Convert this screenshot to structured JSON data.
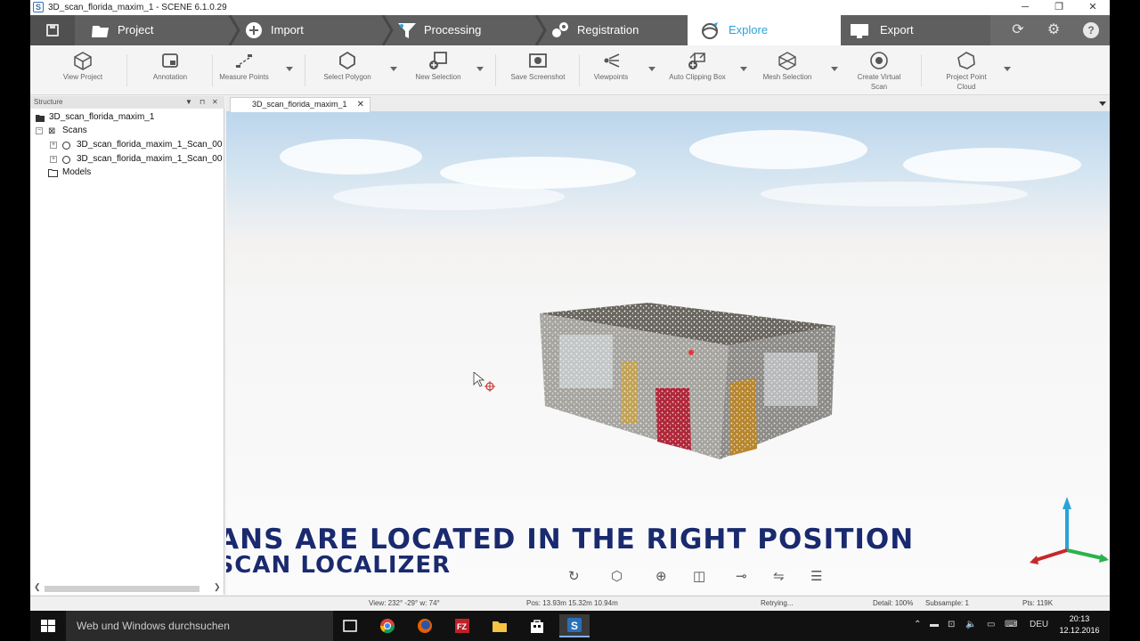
{
  "window": {
    "title": "3D_scan_florida_maxim_1 - SCENE 6.1.0.29",
    "controls": {
      "minimize": "─",
      "restore": "❐",
      "close": "✕"
    }
  },
  "ribbon": {
    "tabs": [
      {
        "label": "Project",
        "icon": "folder-icon"
      },
      {
        "label": "Import",
        "icon": "import-plus-icon"
      },
      {
        "label": "Processing",
        "icon": "filter-icon"
      },
      {
        "label": "Registration",
        "icon": "registration-icon"
      },
      {
        "label": "Explore",
        "icon": "globe-explore-icon",
        "active": true
      },
      {
        "label": "Export",
        "icon": "export-monitor-icon"
      }
    ],
    "accent_color": "#2aa3d8"
  },
  "toolbar": {
    "view_project": "View Project",
    "annotation": "Annotation",
    "measure_points": "Measure Points",
    "select_polygon": "Select Polygon",
    "new_selection": "New Selection",
    "save_screenshot": "Save Screenshot",
    "viewpoints": "Viewpoints",
    "auto_clipping_box": "Auto Clipping Box",
    "mesh_selection": "Mesh Selection",
    "create_virtual_scan_1": "Create Virtual",
    "create_virtual_scan_2": "Scan",
    "project_point_cloud_1": "Project Point",
    "project_point_cloud_2": "Cloud"
  },
  "structure": {
    "header": "Structure",
    "root": "3D_scan_florida_maxim_1",
    "scans_label": "Scans",
    "scan_1": "3D_scan_florida_maxim_1_Scan_00",
    "scan_2": "3D_scan_florida_maxim_1_Scan_00",
    "models_label": "Models"
  },
  "document": {
    "tab_label": "3D_scan_florida_maxim_1"
  },
  "overlay": {
    "caption_line1": "THE SCANS ARE LOCATED IN THE RIGHT POSITION",
    "caption_line2": "BY THE SCAN LOCALIZER"
  },
  "statusbar": {
    "view": "View: 232° -29° w: 74°",
    "pos": "Pos: 13.93m 15.32m 10.94m",
    "state": "Retrying...",
    "detail": "Detail: 100%",
    "subsample": "Subsample:  1",
    "pts": "Pts: 119K"
  },
  "taskbar": {
    "search_placeholder": "Web und Windows durchsuchen",
    "language": "DEU",
    "time": "20:13",
    "date": "12.12.2016"
  }
}
